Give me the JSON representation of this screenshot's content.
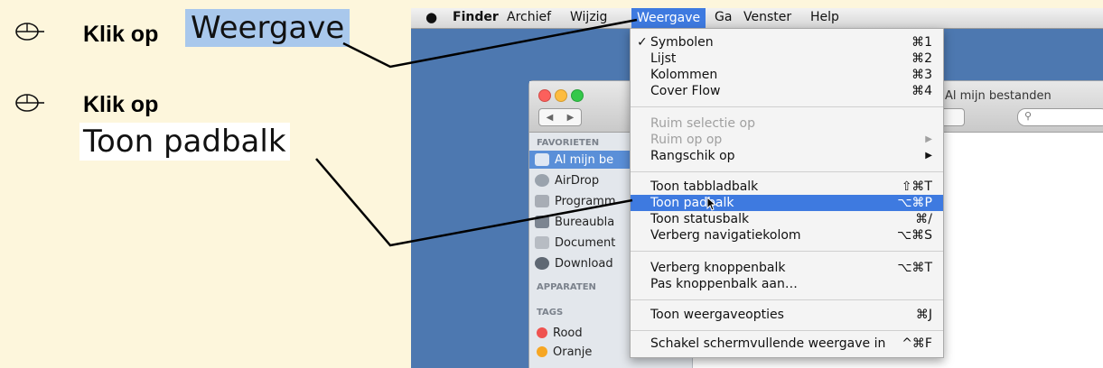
{
  "instructions": {
    "step1": {
      "prefix": "Klik op",
      "keyword": "Weergave"
    },
    "step2": {
      "prefix": "Klik op",
      "keyword": "Toon padbalk"
    }
  },
  "menubar": {
    "items": [
      "Finder",
      "Archief",
      "Wijzig",
      "Weergave",
      "Ga",
      "Venster",
      "Help"
    ],
    "active": "Weergave"
  },
  "finder": {
    "title": "Al mijn bestanden",
    "search_icon": "search-icon",
    "sidebar": {
      "favorites_header": "FAVORIETEN",
      "items": [
        {
          "label": "Al mijn be",
          "icon": "all-files-icon",
          "selected": true
        },
        {
          "label": "AirDrop",
          "icon": "airdrop-icon"
        },
        {
          "label": "Programm",
          "icon": "applications-icon"
        },
        {
          "label": "Bureaubla",
          "icon": "desktop-icon"
        },
        {
          "label": "Document",
          "icon": "documents-icon"
        },
        {
          "label": "Download",
          "icon": "downloads-icon"
        }
      ],
      "devices_header": "APPARATEN",
      "tags_header": "TAGS",
      "tags": [
        {
          "label": "Rood",
          "color": "#ef5350"
        },
        {
          "label": "Oranje",
          "color": "#f6a623"
        }
      ]
    }
  },
  "menu": {
    "items": [
      {
        "label": "Symbolen",
        "shortcut": "⌘1",
        "checked": true
      },
      {
        "label": "Lijst",
        "shortcut": "⌘2"
      },
      {
        "label": "Kolommen",
        "shortcut": "⌘3"
      },
      {
        "label": "Cover Flow",
        "shortcut": "⌘4"
      },
      {
        "label": "Ruim selectie op",
        "shortcut": "",
        "disabled": true
      },
      {
        "label": "Ruim op op",
        "shortcut": "▶",
        "disabled": true
      },
      {
        "label": "Rangschik op",
        "shortcut": "▶"
      },
      {
        "label": "Toon tabbladbalk",
        "shortcut": "⇧⌘T"
      },
      {
        "label": "Toon padbalk",
        "shortcut": "⌥⌘P",
        "highlighted": true
      },
      {
        "label": "Toon statusbalk",
        "shortcut": "⌘/"
      },
      {
        "label": "Verberg navigatiekolom",
        "shortcut": "⌥⌘S"
      },
      {
        "label": "Verberg knoppenbalk",
        "shortcut": "⌥⌘T"
      },
      {
        "label": "Pas knoppenbalk aan…",
        "shortcut": ""
      },
      {
        "label": "Toon weergaveopties",
        "shortcut": "⌘J"
      },
      {
        "label": "Schakel schermvullende weergave in",
        "shortcut": "^⌘F"
      }
    ]
  },
  "colors": {
    "highlight": "#3e7ae0",
    "keyword_bg": "#a9c8ec",
    "panel_bg": "#fdf6dc",
    "desktop": "#4d78b0"
  }
}
